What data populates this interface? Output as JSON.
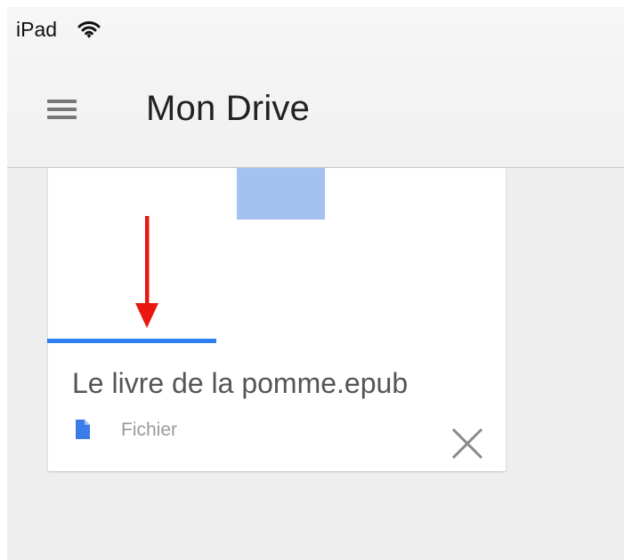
{
  "status_bar": {
    "device": "iPad",
    "wifi_icon": "wifi-icon"
  },
  "header": {
    "title": "Mon Drive",
    "menu_icon": "hamburger-menu-icon"
  },
  "file_card": {
    "name": "Le livre de la pomme.epub",
    "type_label": "Fichier",
    "type_icon": "document-icon",
    "close_icon": "close-icon",
    "progress_fraction": 0.37
  },
  "colors": {
    "progress": "#2d7ff2",
    "thumbnail": "#a4c2f0",
    "arrow": "#e8170f",
    "document_icon": "#3b7de8",
    "background": "#eeeeee"
  }
}
